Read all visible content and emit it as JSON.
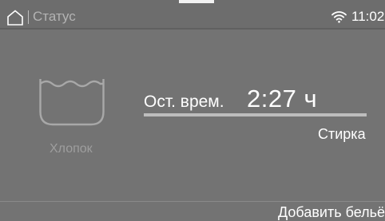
{
  "status_bar": {
    "title": "Статус",
    "time": "11:02",
    "icons": [
      "home-icon",
      "wifi-icon"
    ]
  },
  "program": {
    "name": "Хлопок",
    "icon": "wash-tub-icon"
  },
  "remaining": {
    "label": "Ост. врем.",
    "value": "2:27 ч",
    "progress": 1.0
  },
  "phase": "Стирка",
  "actions": {
    "add_laundry": "Добавить бельё"
  },
  "colors": {
    "background": "#737373",
    "text": "#ffffff",
    "muted_text": "#9e9e9e"
  }
}
